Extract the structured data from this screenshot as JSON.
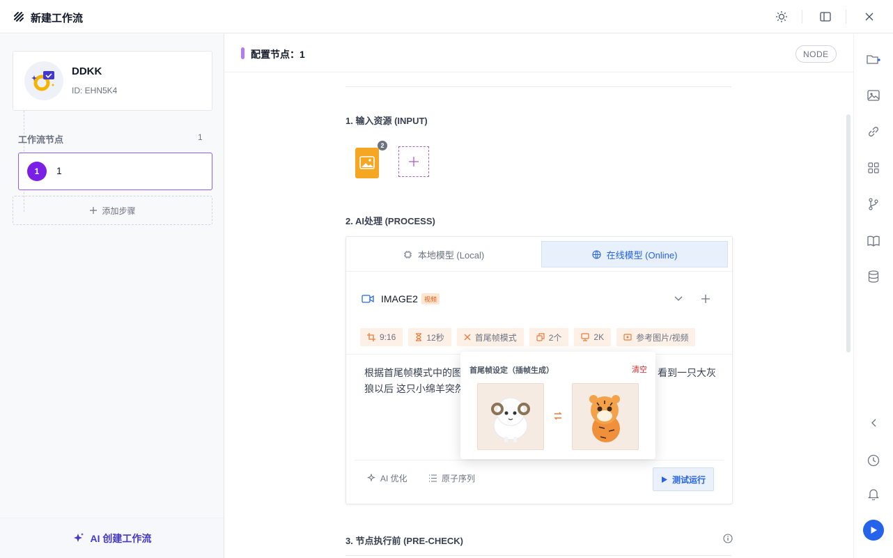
{
  "window": {
    "title": "新建工作流"
  },
  "sidebar": {
    "project": {
      "name": "DDKK",
      "id": "ID: EHN5K4"
    },
    "nodes_label": "工作流节点",
    "nodes_count": "1",
    "nodes": [
      {
        "index": "1",
        "name": "1"
      }
    ],
    "add_step": "添加步骤",
    "ai_create": "AI 创建工作流"
  },
  "main": {
    "config_label": "配置节点：1",
    "node_badge": "NODE",
    "sections": {
      "input": "1. 输入资源 (INPUT)",
      "process": "2. AI处理 (PROCESS)",
      "precheck": "3. 节点执行前 (PRE-CHECK)"
    },
    "input": {
      "file_count_badge": "2"
    },
    "tabs": [
      {
        "label": "本地模型 (Local)",
        "active": false
      },
      {
        "label": "在线模型 (Online)",
        "active": true
      }
    ],
    "model": {
      "name": "IMAGE2",
      "tag": "视频"
    },
    "chips": [
      {
        "label": "9:16",
        "icon": "crop-icon"
      },
      {
        "label": "12秒",
        "icon": "hourglass-icon"
      },
      {
        "label": "首尾帧模式",
        "icon": "close-icon"
      },
      {
        "label": "2个",
        "icon": "copy-icon"
      },
      {
        "label": "2K",
        "icon": "monitor-icon"
      },
      {
        "label": "参考图片/视频",
        "icon": "image-icon"
      }
    ],
    "prompt_line1_a": "根据首尾帧模式中的图片",
    "prompt_line1_b": "看到一只大灰",
    "prompt_line2": "狼以后 这只小绵羊突然变",
    "footer": {
      "ai_optimize": "AI 优化",
      "atomic_sequence": "原子序列",
      "test_run": "测试运行"
    },
    "popup": {
      "title": "首尾帧设定（插帧生成）",
      "clear": "清空"
    }
  },
  "colors": {
    "accent_purple": "#7c1fe6",
    "primary_blue": "#2563eb",
    "chip_bg": "#fdf0e7",
    "clear_red": "#dc2626"
  }
}
